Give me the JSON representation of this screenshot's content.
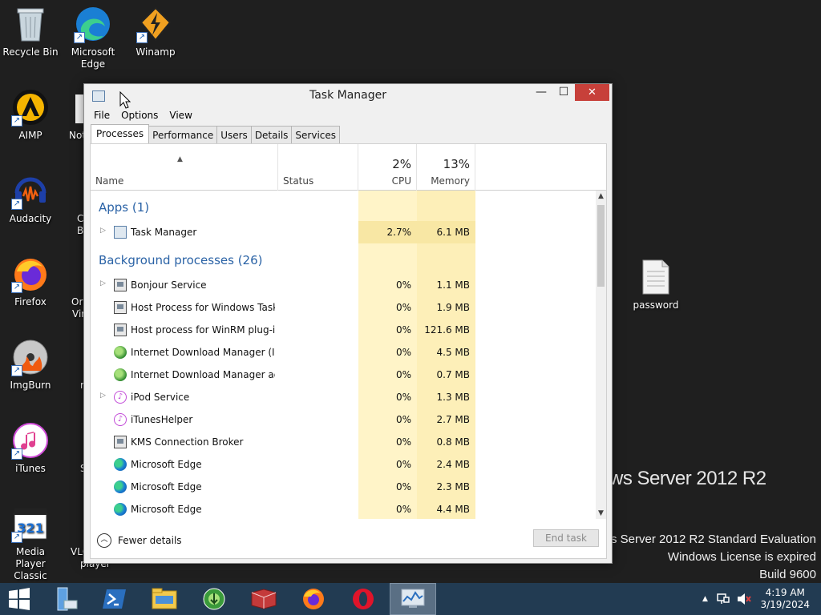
{
  "desktop": {
    "icons": [
      {
        "label": "Recycle Bin",
        "icon": "recycle-bin-icon"
      },
      {
        "label": "Microsoft Edge",
        "icon": "edge-icon"
      },
      {
        "label": "Winamp",
        "icon": "winamp-icon"
      },
      {
        "label": "AIMP",
        "icon": "aimp-icon"
      },
      {
        "label": "Audacity",
        "icon": "audacity-icon"
      },
      {
        "label": "Firefox",
        "icon": "firefox-icon"
      },
      {
        "label": "ImgBurn",
        "icon": "imgburn-icon"
      },
      {
        "label": "iTunes",
        "icon": "itunes-icon"
      },
      {
        "label": "Media Player Classic",
        "icon": "mpc-icon"
      },
      {
        "label": "password",
        "icon": "text-file-icon"
      }
    ],
    "clipped_labels": [
      "Not",
      "C",
      "B",
      "Ora",
      "Vir",
      "r",
      "S",
      "VLC",
      "player"
    ]
  },
  "watermark": {
    "product": "ws Server 2012 R2",
    "edition": "ws Server 2012 R2 Standard Evaluation",
    "license": "Windows License is expired",
    "build": "Build 9600"
  },
  "task_manager": {
    "title": "Task Manager",
    "menu": [
      "File",
      "Options",
      "View"
    ],
    "tabs": [
      "Processes",
      "Performance",
      "Users",
      "Details",
      "Services"
    ],
    "active_tab": "Processes",
    "columns": {
      "name": "Name",
      "status": "Status",
      "cpu_label": "CPU",
      "cpu_total": "2%",
      "memory_label": "Memory",
      "memory_total": "13%"
    },
    "apps_header": "Apps (1)",
    "apps": [
      {
        "name": "Task Manager",
        "cpu": "2.7%",
        "memory": "6.1 MB",
        "icon": "task-manager-icon",
        "expandable": true
      }
    ],
    "background_header": "Background processes (26)",
    "background": [
      {
        "name": "Bonjour Service",
        "cpu": "0%",
        "memory": "1.1 MB",
        "icon": "service-icon",
        "expandable": true
      },
      {
        "name": "Host Process for Windows Tasks",
        "cpu": "0%",
        "memory": "1.9 MB",
        "icon": "service-icon",
        "expandable": false
      },
      {
        "name": "Host process for WinRM plug-ins",
        "cpu": "0%",
        "memory": "121.6 MB",
        "icon": "service-icon",
        "expandable": false
      },
      {
        "name": "Internet Download Manager (ID...",
        "cpu": "0%",
        "memory": "4.5 MB",
        "icon": "idm-icon",
        "expandable": false
      },
      {
        "name": "Internet Download Manager ag...",
        "cpu": "0%",
        "memory": "0.7 MB",
        "icon": "idm-icon",
        "expandable": false
      },
      {
        "name": "iPod Service",
        "cpu": "0%",
        "memory": "1.3 MB",
        "icon": "itunes-icon",
        "expandable": true
      },
      {
        "name": "iTunesHelper",
        "cpu": "0%",
        "memory": "2.7 MB",
        "icon": "itunes-icon",
        "expandable": false
      },
      {
        "name": "KMS Connection Broker",
        "cpu": "0%",
        "memory": "0.8 MB",
        "icon": "service-icon",
        "expandable": false
      },
      {
        "name": "Microsoft Edge",
        "cpu": "0%",
        "memory": "2.4 MB",
        "icon": "edge-icon",
        "expandable": false
      },
      {
        "name": "Microsoft Edge",
        "cpu": "0%",
        "memory": "2.3 MB",
        "icon": "edge-icon",
        "expandable": false
      },
      {
        "name": "Microsoft Edge",
        "cpu": "0%",
        "memory": "4.4 MB",
        "icon": "edge-icon",
        "expandable": false
      }
    ],
    "fewer_details": "Fewer details",
    "end_task": "End task"
  },
  "taskbar": {
    "pinned": [
      "start-icon",
      "server-manager-icon",
      "powershell-icon",
      "file-explorer-icon",
      "idm-icon",
      "winrar-icon",
      "firefox-icon",
      "opera-icon",
      "task-manager-icon"
    ],
    "time": "4:19 AM",
    "date": "3/19/2024"
  },
  "colors": {
    "accent_blue": "#2b63a6",
    "cpu_highlight": "#fff4c8",
    "memory_highlight": "#fdefb8",
    "close_red": "#c7403a",
    "taskbar": "#223b52"
  }
}
